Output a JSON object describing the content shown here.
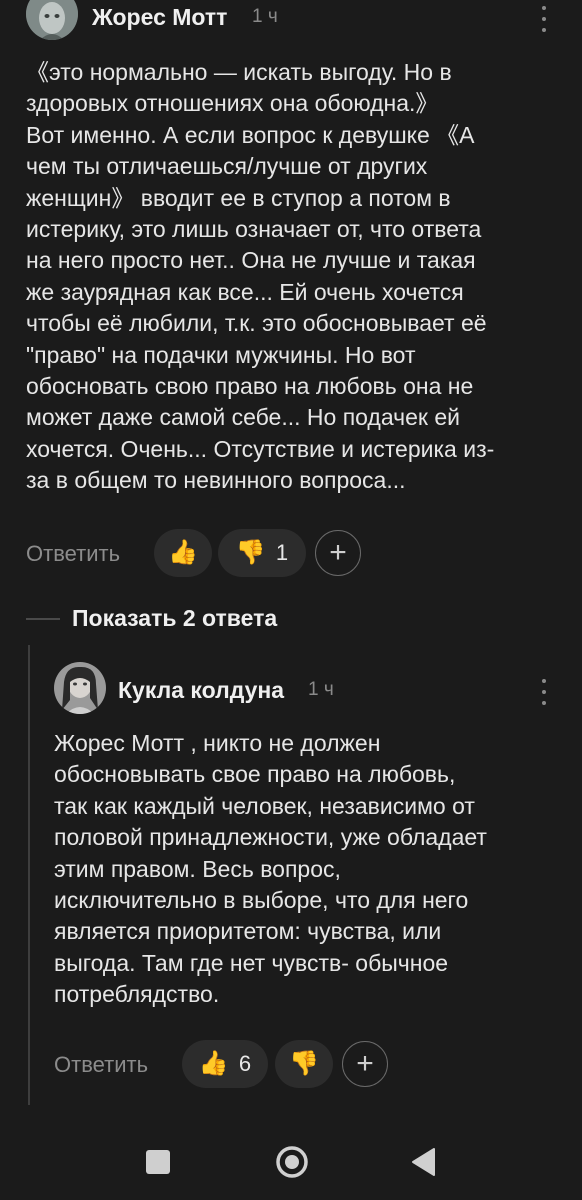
{
  "comment": {
    "author": "Жорес Мотт",
    "time": "1 ч",
    "text": "《это нормально — искать выгоду. Но в\nздоровых отношениях она обоюдна.》\nВот именно. А если вопрос к девушке 《А\nчем ты отличаешься/лучше от других\nженщин》 вводит ее в ступор а потом в\nистерику, это лишь означает от, что ответа\nна него просто нет.. Она не лучше и такая\nже заурядная как все... Ей очень хочется\nчтобы её любили, т.к. это обосновывает её\n\"право\" на подачки мужчины. Но вот\nобосновать свою право на любовь она не\nможет даже самой себе... Но подачек ей\nхочется. Очень... Отсутствие и истерика из-\nза в общем то невинного вопроса...",
    "reply_label": "Ответить",
    "likes": "",
    "dislikes": "1"
  },
  "show_replies_label": "Показать 2 ответа",
  "reply": {
    "author": "Кукла колдуна",
    "time": "1 ч",
    "text": "Жорес Мотт , никто не должен\nобосновывать свое право на любовь,\nтак как каждый человек, независимо от\nполовой принадлежности, уже обладает\nэтим правом. Весь вопрос,\nисключительно в выборе, что для него\nявляется приоритетом: чувства, или\nвыгода. Там где нет чувств- обычное\nпотреблядство.",
    "reply_label": "Ответить",
    "likes": "6",
    "dislikes": ""
  },
  "icons": {
    "like": "thumbs-up-emoji",
    "dislike": "thumbs-down-emoji",
    "add_reaction": "plus",
    "more": "kebab-vertical",
    "nav_recents": "square",
    "nav_home": "circle",
    "nav_back": "triangle-left"
  },
  "colors": {
    "background": "#1b1b1b",
    "pill": "#2c2c2c",
    "muted": "#8a8a8a",
    "emoji": "#f4b400"
  }
}
